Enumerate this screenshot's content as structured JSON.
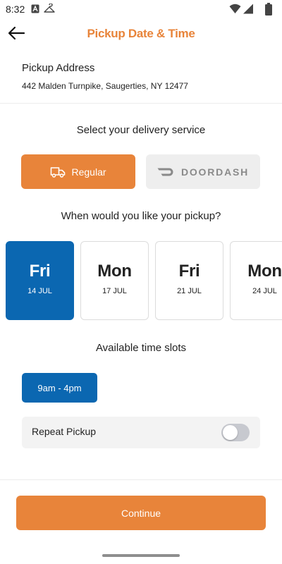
{
  "status_bar": {
    "time": "8:32"
  },
  "header": {
    "title": "Pickup Date & Time"
  },
  "address": {
    "label": "Pickup Address",
    "value": "442 Malden Turnpike, Saugerties, NY 12477"
  },
  "service": {
    "prompt": "Select your delivery service",
    "options": [
      {
        "label": "Regular",
        "icon": "truck-icon",
        "selected": true
      },
      {
        "label": "DOORDASH",
        "icon": "doordash-logo-icon",
        "selected": false
      }
    ]
  },
  "pickup": {
    "prompt": "When would you like your pickup?",
    "dates": [
      {
        "day": "Fri",
        "date": "14 JUL",
        "selected": true
      },
      {
        "day": "Mon",
        "date": "17 JUL",
        "selected": false
      },
      {
        "day": "Fri",
        "date": "21 JUL",
        "selected": false
      },
      {
        "day": "Mon",
        "date": "24 JUL",
        "selected": false
      }
    ]
  },
  "slots": {
    "title": "Available time slots",
    "items": [
      {
        "label": "9am - 4pm",
        "selected": true
      }
    ]
  },
  "repeat": {
    "label": "Repeat Pickup",
    "enabled": false
  },
  "footer": {
    "continue_label": "Continue"
  },
  "colors": {
    "accent": "#E8843A",
    "selected_blue": "#0b67b1"
  }
}
